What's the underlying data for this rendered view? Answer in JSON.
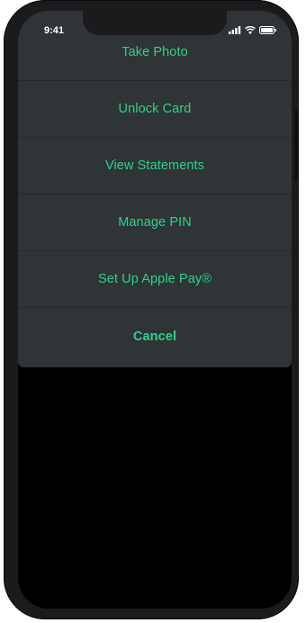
{
  "status_bar": {
    "time": "9:41",
    "icons": [
      "signal-bars-icon",
      "wifi-icon",
      "battery-icon"
    ]
  },
  "action_sheet": {
    "items": [
      {
        "label": "Take Photo"
      },
      {
        "label": "Unlock Card"
      },
      {
        "label": "View Statements"
      },
      {
        "label": "Manage PIN"
      },
      {
        "label": "Set Up Apple Pay®"
      }
    ],
    "cancel_label": "Cancel"
  },
  "colors": {
    "accent": "#2fd28a",
    "sheet_background": "#2f3436",
    "screen_background": "#000000"
  }
}
